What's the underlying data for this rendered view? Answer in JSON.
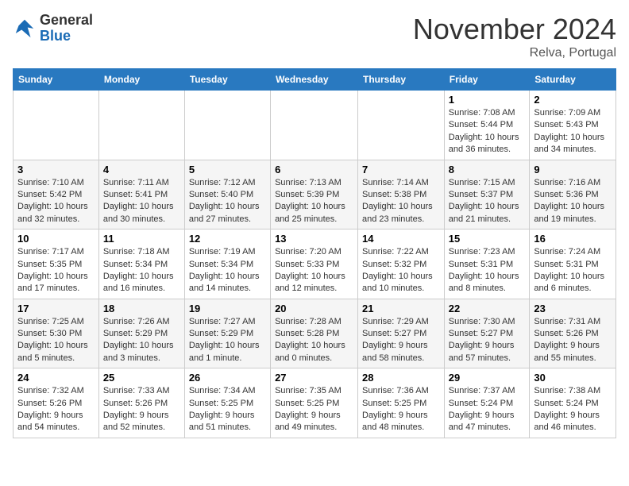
{
  "logo": {
    "general": "General",
    "blue": "Blue"
  },
  "header": {
    "month": "November 2024",
    "location": "Relva, Portugal"
  },
  "weekdays": [
    "Sunday",
    "Monday",
    "Tuesday",
    "Wednesday",
    "Thursday",
    "Friday",
    "Saturday"
  ],
  "weeks": [
    [
      {
        "day": "",
        "info": ""
      },
      {
        "day": "",
        "info": ""
      },
      {
        "day": "",
        "info": ""
      },
      {
        "day": "",
        "info": ""
      },
      {
        "day": "",
        "info": ""
      },
      {
        "day": "1",
        "info": "Sunrise: 7:08 AM\nSunset: 5:44 PM\nDaylight: 10 hours and 36 minutes."
      },
      {
        "day": "2",
        "info": "Sunrise: 7:09 AM\nSunset: 5:43 PM\nDaylight: 10 hours and 34 minutes."
      }
    ],
    [
      {
        "day": "3",
        "info": "Sunrise: 7:10 AM\nSunset: 5:42 PM\nDaylight: 10 hours and 32 minutes."
      },
      {
        "day": "4",
        "info": "Sunrise: 7:11 AM\nSunset: 5:41 PM\nDaylight: 10 hours and 30 minutes."
      },
      {
        "day": "5",
        "info": "Sunrise: 7:12 AM\nSunset: 5:40 PM\nDaylight: 10 hours and 27 minutes."
      },
      {
        "day": "6",
        "info": "Sunrise: 7:13 AM\nSunset: 5:39 PM\nDaylight: 10 hours and 25 minutes."
      },
      {
        "day": "7",
        "info": "Sunrise: 7:14 AM\nSunset: 5:38 PM\nDaylight: 10 hours and 23 minutes."
      },
      {
        "day": "8",
        "info": "Sunrise: 7:15 AM\nSunset: 5:37 PM\nDaylight: 10 hours and 21 minutes."
      },
      {
        "day": "9",
        "info": "Sunrise: 7:16 AM\nSunset: 5:36 PM\nDaylight: 10 hours and 19 minutes."
      }
    ],
    [
      {
        "day": "10",
        "info": "Sunrise: 7:17 AM\nSunset: 5:35 PM\nDaylight: 10 hours and 17 minutes."
      },
      {
        "day": "11",
        "info": "Sunrise: 7:18 AM\nSunset: 5:34 PM\nDaylight: 10 hours and 16 minutes."
      },
      {
        "day": "12",
        "info": "Sunrise: 7:19 AM\nSunset: 5:34 PM\nDaylight: 10 hours and 14 minutes."
      },
      {
        "day": "13",
        "info": "Sunrise: 7:20 AM\nSunset: 5:33 PM\nDaylight: 10 hours and 12 minutes."
      },
      {
        "day": "14",
        "info": "Sunrise: 7:22 AM\nSunset: 5:32 PM\nDaylight: 10 hours and 10 minutes."
      },
      {
        "day": "15",
        "info": "Sunrise: 7:23 AM\nSunset: 5:31 PM\nDaylight: 10 hours and 8 minutes."
      },
      {
        "day": "16",
        "info": "Sunrise: 7:24 AM\nSunset: 5:31 PM\nDaylight: 10 hours and 6 minutes."
      }
    ],
    [
      {
        "day": "17",
        "info": "Sunrise: 7:25 AM\nSunset: 5:30 PM\nDaylight: 10 hours and 5 minutes."
      },
      {
        "day": "18",
        "info": "Sunrise: 7:26 AM\nSunset: 5:29 PM\nDaylight: 10 hours and 3 minutes."
      },
      {
        "day": "19",
        "info": "Sunrise: 7:27 AM\nSunset: 5:29 PM\nDaylight: 10 hours and 1 minute."
      },
      {
        "day": "20",
        "info": "Sunrise: 7:28 AM\nSunset: 5:28 PM\nDaylight: 10 hours and 0 minutes."
      },
      {
        "day": "21",
        "info": "Sunrise: 7:29 AM\nSunset: 5:27 PM\nDaylight: 9 hours and 58 minutes."
      },
      {
        "day": "22",
        "info": "Sunrise: 7:30 AM\nSunset: 5:27 PM\nDaylight: 9 hours and 57 minutes."
      },
      {
        "day": "23",
        "info": "Sunrise: 7:31 AM\nSunset: 5:26 PM\nDaylight: 9 hours and 55 minutes."
      }
    ],
    [
      {
        "day": "24",
        "info": "Sunrise: 7:32 AM\nSunset: 5:26 PM\nDaylight: 9 hours and 54 minutes."
      },
      {
        "day": "25",
        "info": "Sunrise: 7:33 AM\nSunset: 5:26 PM\nDaylight: 9 hours and 52 minutes."
      },
      {
        "day": "26",
        "info": "Sunrise: 7:34 AM\nSunset: 5:25 PM\nDaylight: 9 hours and 51 minutes."
      },
      {
        "day": "27",
        "info": "Sunrise: 7:35 AM\nSunset: 5:25 PM\nDaylight: 9 hours and 49 minutes."
      },
      {
        "day": "28",
        "info": "Sunrise: 7:36 AM\nSunset: 5:25 PM\nDaylight: 9 hours and 48 minutes."
      },
      {
        "day": "29",
        "info": "Sunrise: 7:37 AM\nSunset: 5:24 PM\nDaylight: 9 hours and 47 minutes."
      },
      {
        "day": "30",
        "info": "Sunrise: 7:38 AM\nSunset: 5:24 PM\nDaylight: 9 hours and 46 minutes."
      }
    ]
  ]
}
